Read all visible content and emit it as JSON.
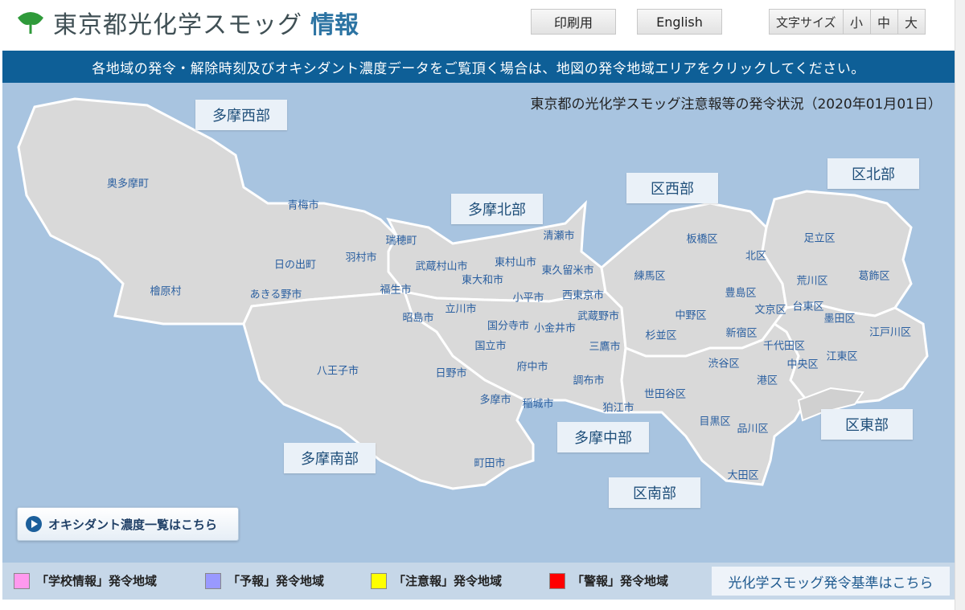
{
  "header": {
    "title": "東京都光化学スモッグ",
    "title_accent": "情報",
    "print_label": "印刷用",
    "english_label": "English",
    "font_size_label": "文字サイズ",
    "font_sizes": [
      "小",
      "中",
      "大"
    ]
  },
  "banner": {
    "text": "各地域の発令・解除時刻及びオキシダント濃度データをご覧頂く場合は、地図の発令地域エリアをクリックしてください。"
  },
  "map": {
    "status_text": "東京都の光化学スモッグ注意報等の発令状況（2020年01月01日）",
    "regions": [
      "多摩西部",
      "多摩北部",
      "区西部",
      "区北部",
      "多摩中部",
      "区南部",
      "多摩南部",
      "区東部"
    ],
    "cities": [
      "奥多摩町",
      "青梅市",
      "瑞穂町",
      "清瀬市",
      "板橋区",
      "北区",
      "足立区",
      "羽村市",
      "日の出町",
      "武蔵村山市",
      "東村山市",
      "東久留米市",
      "東大和市",
      "練馬区",
      "荒川区",
      "葛飾区",
      "福生市",
      "檜原村",
      "あきる野市",
      "小平市",
      "西東京市",
      "豊島区",
      "台東区",
      "文京区",
      "立川市",
      "昭島市",
      "武蔵野市",
      "中野区",
      "墨田区",
      "国分寺市",
      "小金井市",
      "杉並区",
      "新宿区",
      "江戸川区",
      "国立市",
      "三鷹市",
      "千代田区",
      "八王子市",
      "府中市",
      "渋谷区",
      "江東区",
      "中央区",
      "日野市",
      "調布市",
      "港区",
      "多摩市",
      "稲城市",
      "世田谷区",
      "狛江市",
      "目黒区",
      "品川区",
      "町田市",
      "大田区"
    ]
  },
  "oxidant_button": {
    "label": "オキシダント濃度一覧はこちら"
  },
  "legend": {
    "items": [
      {
        "label": "「学校情報」発令地域",
        "color": "#ff99ee"
      },
      {
        "label": "「予報」発令地域",
        "color": "#9999ff"
      },
      {
        "label": "「注意報」発令地域",
        "color": "#ffff00"
      },
      {
        "label": "「警報」発令地域",
        "color": "#ff0000"
      }
    ],
    "criteria_link": "光化学スモッグ発令基準はこちら"
  },
  "colors": {
    "banner": "#0e5f97",
    "map_background": "#a8c4e0",
    "land": "#d9d9d9",
    "city_text": "#2a5fa0"
  }
}
